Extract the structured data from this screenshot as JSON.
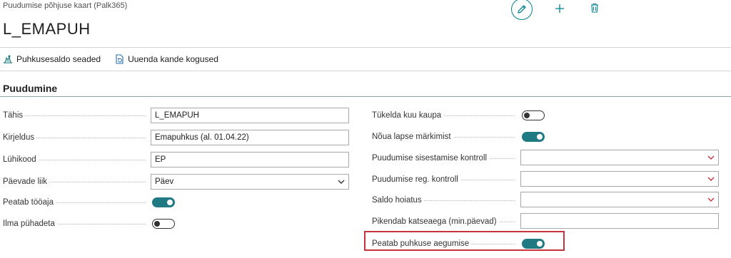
{
  "header": {
    "breadcrumb": "Puudumise põhjuse kaart (Palk365)",
    "title": "L_EMAPUH",
    "icons": {
      "edit": "edit-icon",
      "add": "plus-icon",
      "delete": "trash-icon"
    }
  },
  "actions": [
    {
      "label": "Puhkusesaldo seaded",
      "icon": "balance-settings-icon"
    },
    {
      "label": "Uuenda kande kogused",
      "icon": "refresh-document-icon"
    }
  ],
  "section": {
    "title": "Puudumine"
  },
  "left_fields": [
    {
      "label": "Tähis",
      "value": "L_EMAPUH"
    },
    {
      "label": "Kirjeldus",
      "value": "Emapuhkus (al. 01.04.22)"
    },
    {
      "label": "Lühikood",
      "value": "EP"
    },
    {
      "label": "Päevade liik",
      "value": "Päev"
    },
    {
      "label": "Peatab tööaja",
      "toggle": "on"
    },
    {
      "label": "Ilma pühadeta",
      "toggle": "off"
    }
  ],
  "right_fields": [
    {
      "label": "Tükelda kuu kaupa",
      "toggle": "off"
    },
    {
      "label": "Nõua lapse märkimist",
      "toggle": "on"
    },
    {
      "label": "Puudumise sisestamise kontroll",
      "value": ""
    },
    {
      "label": "Puudumise reg. kontroll",
      "value": ""
    },
    {
      "label": "Saldo hoiatus",
      "value": ""
    },
    {
      "label": "Pikendab katseaega (min.päevad)",
      "value": ""
    },
    {
      "label": "Peatab puhkuse aegumise",
      "toggle": "on"
    }
  ],
  "colors": {
    "accent": "#1f7a83",
    "highlight": "#c8323a",
    "select_arrow": "#c8323a"
  }
}
